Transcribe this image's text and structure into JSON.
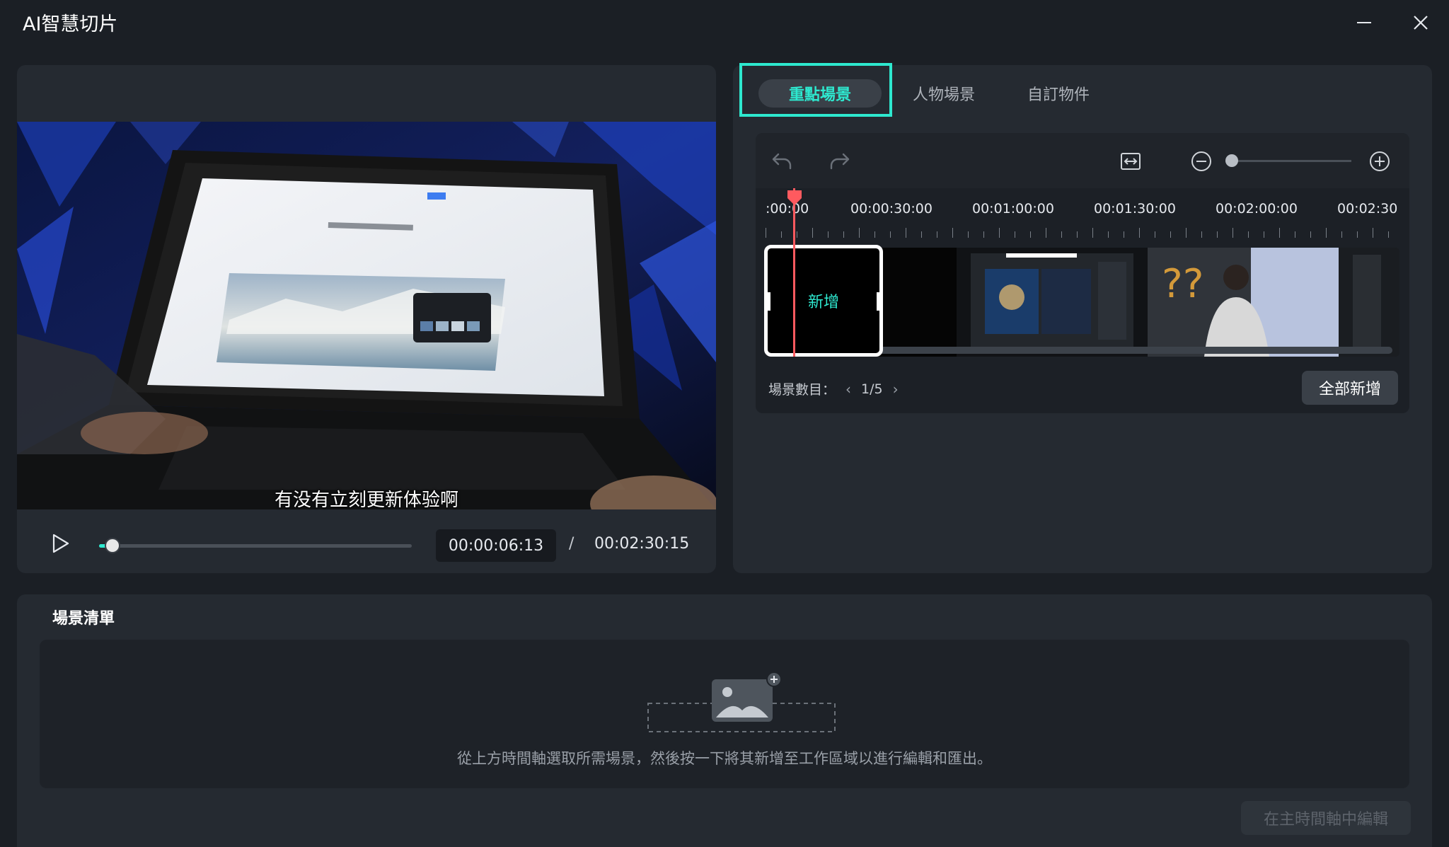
{
  "window": {
    "title": "AI智慧切片",
    "minimize_icon": "minimize-icon",
    "close_icon": "close-icon"
  },
  "player": {
    "subtitle": "有没有立刻更新体验啊",
    "current_time": "00:00:06:13",
    "separator": "/",
    "total_time": "00:02:30:15",
    "progress_fraction": 0.043,
    "play_icon": "play-icon"
  },
  "tabs": [
    {
      "label": "重點場景",
      "active": true
    },
    {
      "label": "人物場景",
      "active": false
    },
    {
      "label": "自訂物件",
      "active": false
    }
  ],
  "timeline": {
    "toolbar_icons": [
      "undo-icon",
      "redo-icon",
      "fit-to-width-icon",
      "zoom-out-icon",
      "zoom-in-icon"
    ],
    "zoom_level_fraction": 0.0,
    "ruler_labels": [
      ":00:00",
      "00:00:30:00",
      "00:01:00:00",
      "00:01:30:00",
      "00:02:00:00",
      "00:02:30"
    ],
    "selected_clip_label": "新增",
    "scene_count_label": "場景數目：",
    "scene_count_value": "1/5",
    "add_all_label": "全部新增"
  },
  "scene_list": {
    "title": "場景清單",
    "hint": "從上方時間軸選取所需場景，然後按一下將其新增至工作區域以進行編輯和匯出。",
    "edit_button_label": "在主時間軸中編輯"
  },
  "colors": {
    "accent": "#2ee8cf",
    "playhead": "#ff5a5f",
    "background": "#1b1f25",
    "panel": "#252a31"
  }
}
